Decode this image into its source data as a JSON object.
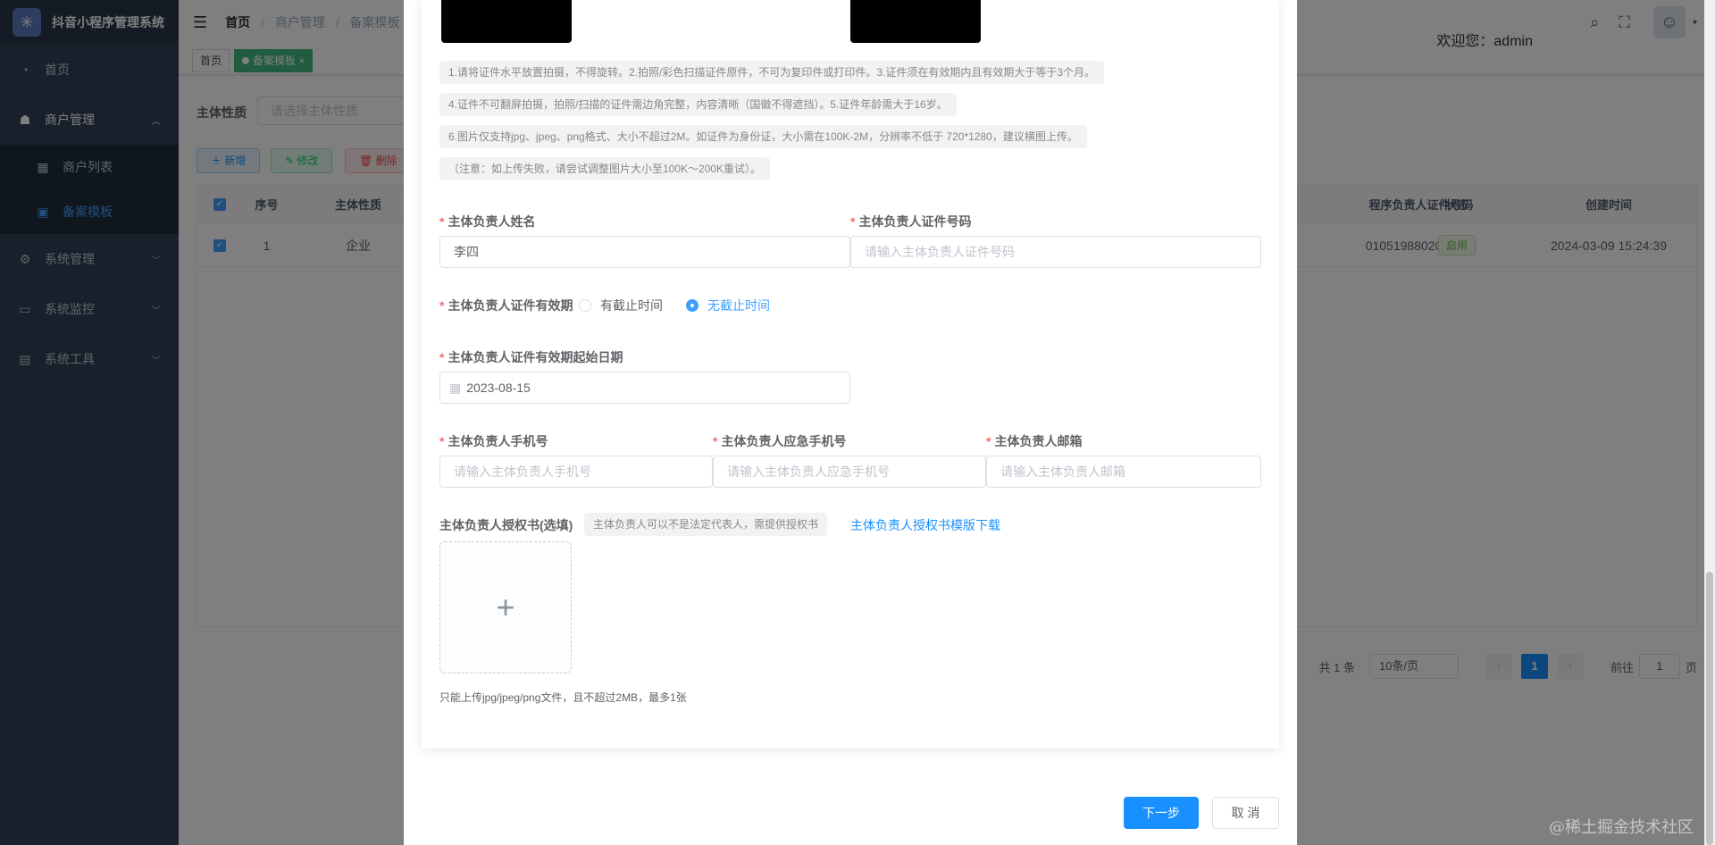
{
  "app": {
    "title": "抖音小程序管理系统"
  },
  "sidebar": {
    "items": [
      {
        "label": "首页",
        "icon": "dashboard-icon"
      },
      {
        "label": "商户管理",
        "icon": "merchant-icon"
      },
      {
        "label": "系统管理",
        "icon": "settings-icon"
      },
      {
        "label": "系统监控",
        "icon": "monitor-icon"
      },
      {
        "label": "系统工具",
        "icon": "tool-icon"
      }
    ],
    "sub_items": [
      {
        "label": "商户列表",
        "icon": "list-icon"
      },
      {
        "label": "备案模板",
        "icon": "template-icon"
      }
    ]
  },
  "navbar": {
    "breadcrumb": [
      "首页",
      "商户管理",
      "备案模板"
    ],
    "welcome": "欢迎您：admin"
  },
  "tags": [
    "首页",
    "备案模板"
  ],
  "page": {
    "query_label": "主体性质",
    "query_placeholder": "请选择主体性质",
    "buttons": {
      "add": "新增",
      "edit": "修改",
      "delete": "删除"
    },
    "table": {
      "headers": {
        "index": "序号",
        "nature": "主体性质",
        "id_number": "程序负责人证件号码",
        "status": "状态",
        "created": "创建时间"
      },
      "row": {
        "index": "1",
        "nature": "企业",
        "id_number": "0105198802023334",
        "status": "启用",
        "created": "2024-03-09 15:24:39"
      }
    },
    "pagination": {
      "total": "共 1 条",
      "page_size": "10条/页",
      "current": "1",
      "goto_label": "前往",
      "goto_value": "1",
      "page_suffix": "页"
    }
  },
  "dialog": {
    "tips": [
      "1.请将证件水平放置拍摄，不得旋转。2.拍照/彩色扫描证件原件，不可为复印件或打印件。3.证件须在有效期内且有效期大于等于3个月。",
      "4.证件不可翻屏拍摄，拍照/扫描的证件需边角完整，内容清晰（国徽不得遮挡）。5.证件年龄需大于16岁。",
      "6.图片仅支持jpg、jpeg、png格式、大小不超过2M。如证件为身份证，大小需在100K-2M，分辨率不低于 720*1280，建议横图上传。",
      "（注意：如上传失败，请尝试调整图片大小至100K～200K重试）。"
    ],
    "owner_name": {
      "label": "主体负责人姓名",
      "value": "李四"
    },
    "owner_id": {
      "label": "主体负责人证件号码",
      "placeholder": "请输入主体负责人证件号码"
    },
    "validity": {
      "label": "主体负责人证件有效期",
      "option_limited": "有截止时间",
      "option_unlimited": "无截止时间"
    },
    "start_date": {
      "label": "主体负责人证件有效期起始日期",
      "value": "2023-08-15"
    },
    "phone": {
      "label": "主体负责人手机号",
      "placeholder": "请输入主体负责人手机号"
    },
    "emergency_phone": {
      "label": "主体负责人应急手机号",
      "placeholder": "请输入主体负责人应急手机号"
    },
    "email": {
      "label": "主体负责人邮箱",
      "placeholder": "请输入主体负责人邮箱"
    },
    "auth_letter": {
      "label": "主体负责人授权书(选填)",
      "hint": "主体负责人可以不是法定代表人，需提供授权书",
      "download_link": "主体负责人授权书模版下载",
      "upload_note": "只能上传jpg/jpeg/png文件，且不超过2MB，最多1张"
    },
    "next_button": "下一步",
    "cancel_button": "取 消"
  },
  "watermark": "@稀土掘金技术社区",
  "colors": {
    "primary": "#1890ff",
    "sidebar_bg": "#304156",
    "required": "#f56c6c",
    "success": "#67c23a"
  }
}
